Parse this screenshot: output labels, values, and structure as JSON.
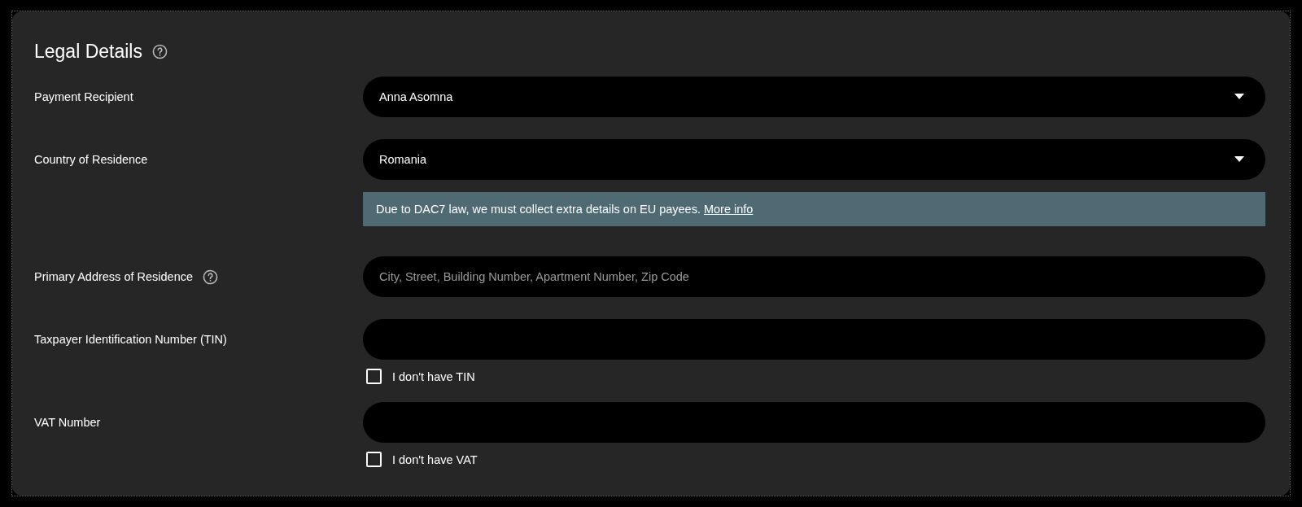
{
  "section": {
    "title": "Legal Details",
    "help": true
  },
  "fields": [
    {
      "label": "Payment Recipient",
      "help": false,
      "kind": "select",
      "value": "Anna Asomna"
    },
    {
      "label": "Country of Residence",
      "help": false,
      "kind": "select",
      "value": "Romania",
      "notice": {
        "text": "Due to DAC7 law, we must collect extra details on EU payees.",
        "link": "More info"
      }
    },
    {
      "label": "Primary Address of Residence",
      "help": true,
      "kind": "text",
      "placeholder": "City, Street, Building Number, Apartment Number, Zip Code"
    },
    {
      "label": "Taxpayer Identification Number (TIN)",
      "help": false,
      "kind": "text",
      "checkbox": {
        "label": "I don't have TIN",
        "checked": false
      }
    },
    {
      "label": "VAT Number",
      "help": false,
      "kind": "text",
      "checkbox": {
        "label": "I don't have VAT",
        "checked": false
      }
    }
  ]
}
